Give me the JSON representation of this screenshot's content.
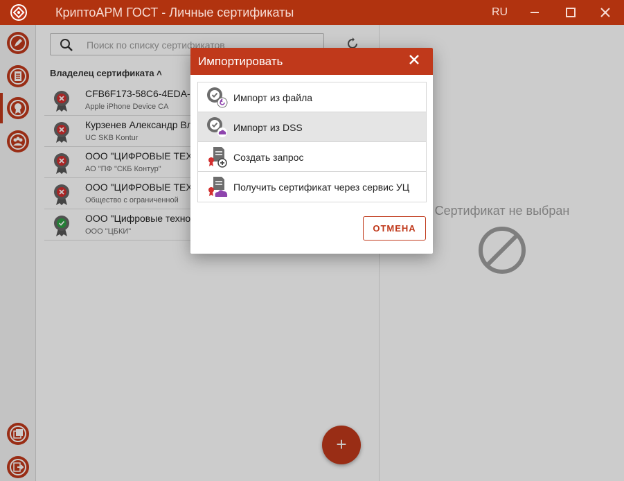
{
  "window": {
    "title": "КриптоАРМ ГОСТ - Личные сертификаты",
    "language": "RU"
  },
  "sidebar": {
    "items": [
      {
        "name": "sign",
        "icon": "pen-icon"
      },
      {
        "name": "documents",
        "icon": "document-list-icon"
      },
      {
        "name": "certificates",
        "icon": "certificate-icon",
        "active": true
      },
      {
        "name": "contacts",
        "icon": "users-icon"
      },
      {
        "name": "journal",
        "icon": "events-icon"
      },
      {
        "name": "exit",
        "icon": "exit-icon"
      }
    ]
  },
  "search": {
    "placeholder": "Поиск по списку сертификатов"
  },
  "list": {
    "column_header": "Владелец сертификата ˄",
    "rows": [
      {
        "owner": "CFB6F173-58C6-4EDA-B",
        "issuer": "Apple iPhone Device CA",
        "status": "invalid"
      },
      {
        "owner": "Курзенев Александр Вл",
        "issuer": "UC SKB Kontur",
        "status": "invalid"
      },
      {
        "owner": "ООО \"ЦИФРОВЫЕ ТЕХНО",
        "issuer": "АО \"ПФ \"СКБ Контур\"",
        "status": "invalid"
      },
      {
        "owner": "ООО \"ЦИФРОВЫЕ ТЕХН",
        "issuer": "Общество с ограниченной",
        "status": "invalid"
      },
      {
        "owner": "ООО \"Цифровые технол",
        "issuer": "ООО \"ЦБКИ\"",
        "status": "valid"
      }
    ]
  },
  "fab": {
    "label": "+"
  },
  "detail": {
    "empty_text": "Сертификат не выбран"
  },
  "modal": {
    "title": "Импортировать",
    "close_label": "✕",
    "items": [
      {
        "label": "Импорт из файла",
        "icon": "import-file-icon"
      },
      {
        "label": "Импорт из DSS",
        "icon": "import-dss-icon",
        "hovered": true
      },
      {
        "label": "Создать запрос",
        "icon": "create-request-icon"
      },
      {
        "label": "Получить сертификат через сервис УЦ",
        "icon": "get-cert-ca-icon"
      }
    ],
    "cancel_label": "ОТМЕНА"
  },
  "colors": {
    "brand": "#c0391b",
    "titlebar": "#b1330f",
    "invalid": "#d32f2f",
    "valid": "#2e9e44"
  }
}
